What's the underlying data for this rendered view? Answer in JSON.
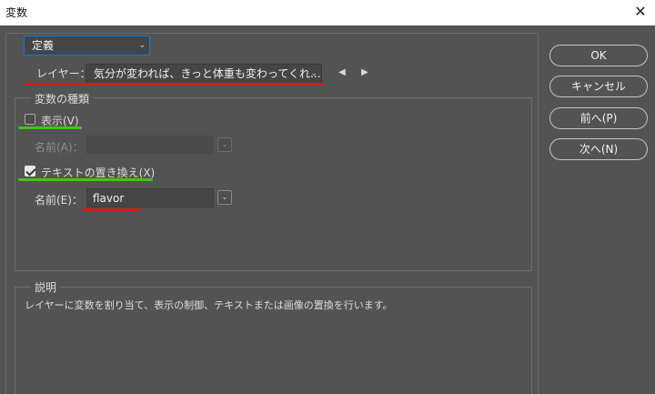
{
  "window": {
    "title": "変数",
    "close_icon": "close-icon"
  },
  "preset": {
    "selected": "定義"
  },
  "layer": {
    "label": "レイヤー：",
    "selected": "気分が変われば、きっと体重も変わってくれ..."
  },
  "variable_type": {
    "title": "変数の種類",
    "visibility": {
      "label": "表示(V)",
      "checked": false,
      "name_label": "名前(A)：",
      "name_value": ""
    },
    "text_replace": {
      "label": "テキストの置き換え(X)",
      "checked": true,
      "name_label": "名前(E)：",
      "name_value": "flavor"
    }
  },
  "description": {
    "title": "説明",
    "text": "レイヤーに変数を割り当て、表示の制御、テキストまたは画像の置換を行います。"
  },
  "buttons": {
    "ok": "OK",
    "cancel": "キャンセル",
    "prev": "前へ(P)",
    "next": "次へ(N)"
  },
  "colors": {
    "background": "#535353",
    "highlight_red": "#d9191f",
    "highlight_green": "#45c21a",
    "focus_blue": "#2f6fb7"
  }
}
